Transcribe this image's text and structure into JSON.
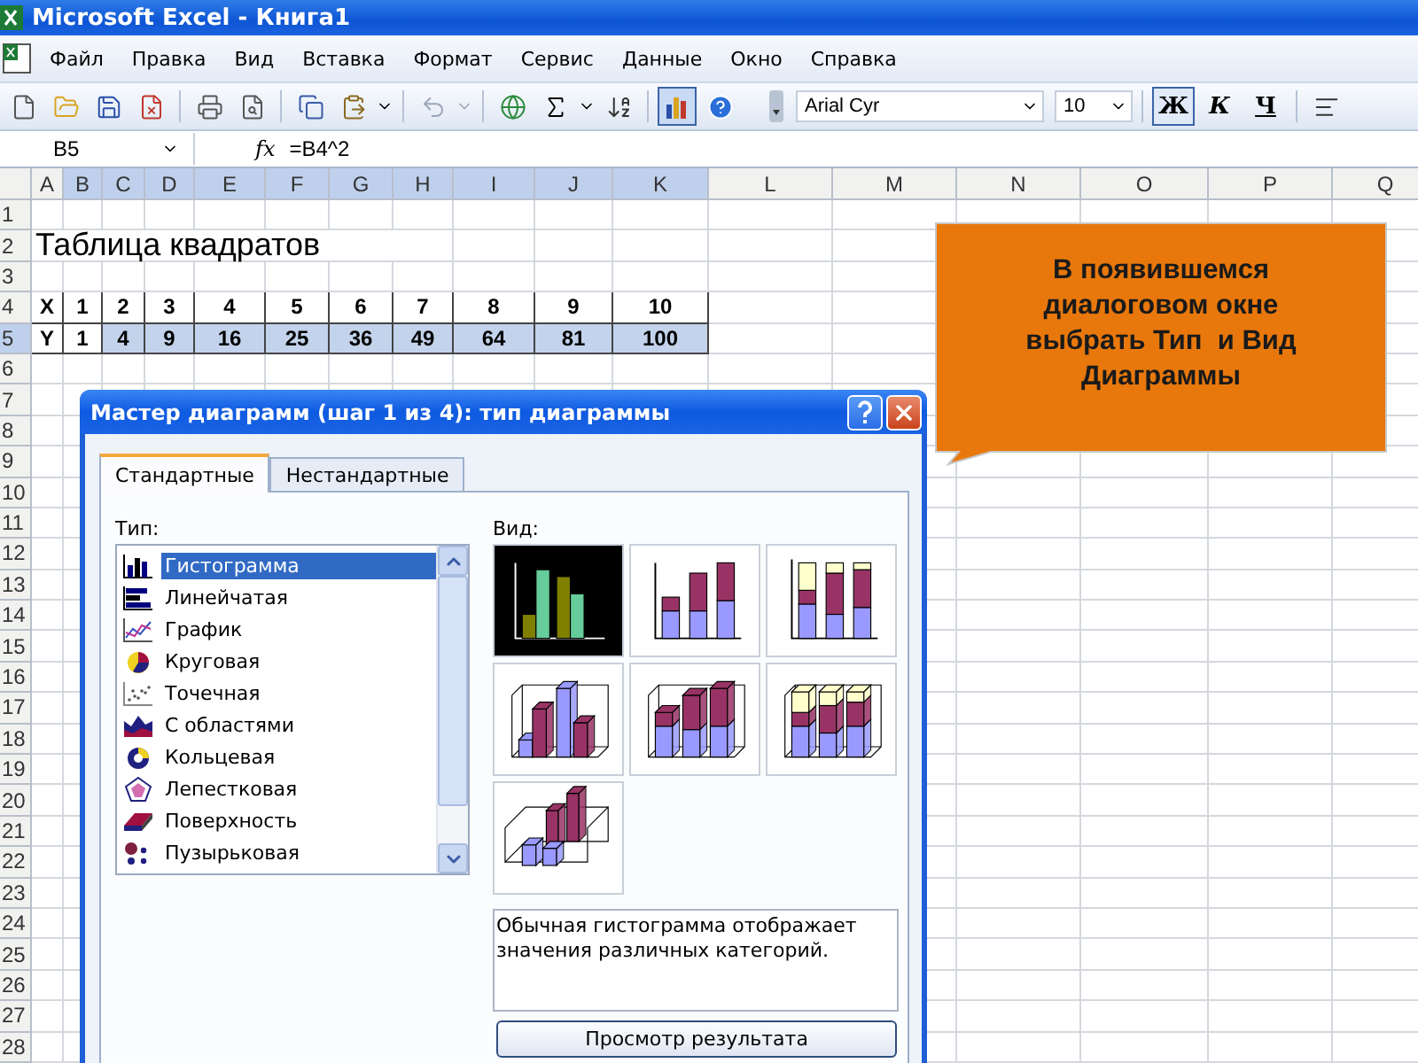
{
  "window": {
    "title": "Microsoft Excel - Книга1"
  },
  "menu": [
    "Файл",
    "Правка",
    "Вид",
    "Вставка",
    "Формат",
    "Сервис",
    "Данные",
    "Окно",
    "Справка"
  ],
  "toolbar": {
    "chart_wizard_active": true,
    "font": "Arial Cyr",
    "size": "10",
    "format_buttons": [
      {
        "label": "Ж",
        "pressed": true
      },
      {
        "label": "К",
        "pressed": false
      },
      {
        "label": "Ч",
        "pressed": false
      }
    ]
  },
  "formula_bar": {
    "cell": "B5",
    "fx_label": "fx",
    "formula": "=B4^2"
  },
  "sheet": {
    "columns": [
      {
        "label": "A",
        "selected": false
      },
      {
        "label": "B",
        "selected": true
      },
      {
        "label": "C",
        "selected": true
      },
      {
        "label": "D",
        "selected": true
      },
      {
        "label": "E",
        "selected": true
      },
      {
        "label": "F",
        "selected": true
      },
      {
        "label": "G",
        "selected": true
      },
      {
        "label": "H",
        "selected": true
      },
      {
        "label": "I",
        "selected": true
      },
      {
        "label": "J",
        "selected": true
      },
      {
        "label": "K",
        "selected": true
      },
      {
        "label": "L",
        "selected": false
      },
      {
        "label": "M",
        "selected": false
      },
      {
        "label": "N",
        "selected": false
      },
      {
        "label": "O",
        "selected": false
      },
      {
        "label": "P",
        "selected": false
      },
      {
        "label": "Q",
        "selected": false
      }
    ],
    "rows": [
      {
        "label": "1",
        "selected": false
      },
      {
        "label": "2",
        "selected": false,
        "cells": [
          {
            "text": "Таблица квадратов"
          }
        ],
        "kind": "title"
      },
      {
        "label": "3",
        "selected": false
      },
      {
        "label": "4",
        "selected": false,
        "kind": "table",
        "cells": [
          {
            "text": "X"
          },
          {
            "text": "1"
          },
          {
            "text": "2"
          },
          {
            "text": "3"
          },
          {
            "text": "4"
          },
          {
            "text": "5"
          },
          {
            "text": "6"
          },
          {
            "text": "7"
          },
          {
            "text": "8"
          },
          {
            "text": "9"
          },
          {
            "text": "10"
          }
        ]
      },
      {
        "label": "5",
        "selected": true,
        "kind": "table",
        "cells": [
          {
            "text": "Y",
            "selected": false
          },
          {
            "text": "1",
            "selected": false
          },
          {
            "text": "4",
            "selected": true
          },
          {
            "text": "9",
            "selected": true
          },
          {
            "text": "16",
            "selected": true
          },
          {
            "text": "25",
            "selected": true
          },
          {
            "text": "36",
            "selected": true
          },
          {
            "text": "49",
            "selected": true
          },
          {
            "text": "64",
            "selected": true
          },
          {
            "text": "81",
            "selected": true
          },
          {
            "text": "100",
            "selected": true
          }
        ]
      },
      {
        "label": "6",
        "selected": false
      },
      {
        "label": "7",
        "selected": false
      },
      {
        "label": "8",
        "selected": false
      },
      {
        "label": "9",
        "selected": false
      },
      {
        "label": "10",
        "selected": false
      },
      {
        "label": "11",
        "selected": false
      },
      {
        "label": "12",
        "selected": false
      },
      {
        "label": "13",
        "selected": false
      },
      {
        "label": "14",
        "selected": false
      },
      {
        "label": "15",
        "selected": false
      },
      {
        "label": "16",
        "selected": false
      },
      {
        "label": "17",
        "selected": false
      },
      {
        "label": "18",
        "selected": false
      },
      {
        "label": "19",
        "selected": false
      },
      {
        "label": "20",
        "selected": false
      },
      {
        "label": "21",
        "selected": false
      },
      {
        "label": "22",
        "selected": false
      },
      {
        "label": "23",
        "selected": false
      },
      {
        "label": "24",
        "selected": false
      },
      {
        "label": "25",
        "selected": false
      },
      {
        "label": "26",
        "selected": false
      },
      {
        "label": "27",
        "selected": false
      },
      {
        "label": "28",
        "selected": false
      }
    ]
  },
  "dialog": {
    "title": "Мастер диаграмм (шаг 1 из 4): тип диаграммы",
    "tabs": [
      {
        "label": "Стандартные",
        "selected": true
      },
      {
        "label": "Нестандартные",
        "selected": false
      }
    ],
    "type_label": "Тип:",
    "types": [
      {
        "label": "Гистограмма",
        "kind": "column",
        "selected": true
      },
      {
        "label": "Линейчатая",
        "kind": "bar",
        "selected": false
      },
      {
        "label": "График",
        "kind": "line",
        "selected": false
      },
      {
        "label": "Круговая",
        "kind": "pie",
        "selected": false
      },
      {
        "label": "Точечная",
        "kind": "scatter",
        "selected": false
      },
      {
        "label": "С областями",
        "kind": "area",
        "selected": false
      },
      {
        "label": "Кольцевая",
        "kind": "doughnut",
        "selected": false
      },
      {
        "label": "Лепестковая",
        "kind": "radar",
        "selected": false
      },
      {
        "label": "Поверхность",
        "kind": "surface",
        "selected": false
      },
      {
        "label": "Пузырьковая",
        "kind": "bubble",
        "selected": false
      }
    ],
    "view_label": "Вид:",
    "subtypes": [
      {
        "kind": "clustered",
        "selected": true
      },
      {
        "kind": "stacked",
        "selected": false
      },
      {
        "kind": "percent",
        "selected": false
      },
      {
        "kind": "clustered3d",
        "selected": false
      },
      {
        "kind": "stacked3d",
        "selected": false
      },
      {
        "kind": "percent3d",
        "selected": false
      },
      {
        "kind": "column3d",
        "selected": false
      }
    ],
    "description": "Обычная гистограмма отображает значения различных категорий.",
    "preview_button": "Просмотр результата"
  },
  "callout": {
    "text": "В появившемся\nдиалоговом окне\nвыбрать Тип  и Вид\nДиаграммы"
  }
}
